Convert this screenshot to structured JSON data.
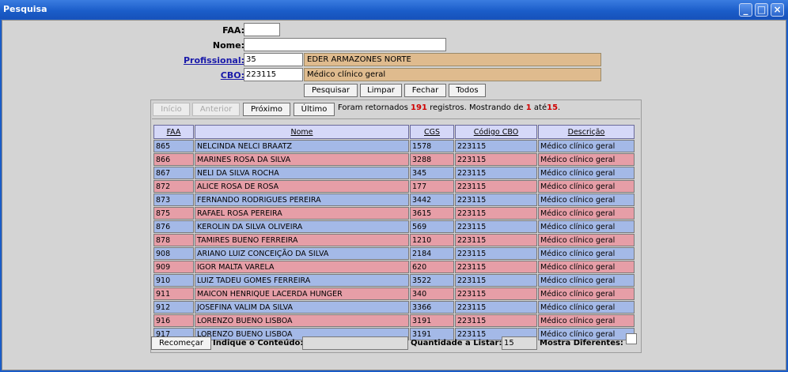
{
  "window": {
    "title": "Pesquisa"
  },
  "form": {
    "faa_label": "FAA:",
    "faa_value": "",
    "nome_label": "Nome:",
    "nome_value": "",
    "profissional_label": "Profissional:",
    "profissional_code": "35",
    "profissional_name": "EDER ARMAZONES NORTE",
    "cbo_label": "CBO:",
    "cbo_code": "223115",
    "cbo_desc": "Médico clínico geral"
  },
  "actions": {
    "pesquisar": "Pesquisar",
    "limpar": "Limpar",
    "fechar": "Fechar",
    "todos": "Todos"
  },
  "nav": {
    "inicio": "Início",
    "anterior": "Anterior",
    "proximo": "Próximo",
    "ultimo": "Último",
    "info_prefix": "Foram retornados",
    "total": "191",
    "info_mid": "registros. Mostrando de",
    "from": "1",
    "info_to": "até",
    "to": "15",
    "info_end": "."
  },
  "table": {
    "headers": [
      "FAA",
      "Nome",
      "CGS",
      "Código CBO",
      "Descrição"
    ],
    "rows": [
      [
        "865",
        "NELCINDA NELCI BRAATZ",
        "1578",
        "223115",
        "Médico clínico geral"
      ],
      [
        "866",
        "MARINES ROSA DA SILVA",
        "3288",
        "223115",
        "Médico clínico geral"
      ],
      [
        "867",
        "NELI DA SILVA ROCHA",
        "345",
        "223115",
        "Médico clínico geral"
      ],
      [
        "872",
        "ALICE ROSA DE ROSA",
        "177",
        "223115",
        "Médico clínico geral"
      ],
      [
        "873",
        "FERNANDO RODRIGUES PEREIRA",
        "3442",
        "223115",
        "Médico clínico geral"
      ],
      [
        "875",
        "RAFAEL ROSA PEREIRA",
        "3615",
        "223115",
        "Médico clínico geral"
      ],
      [
        "876",
        "KEROLIN DA SILVA OLIVEIRA",
        "569",
        "223115",
        "Médico clínico geral"
      ],
      [
        "878",
        "TAMIRES BUENO FERREIRA",
        "1210",
        "223115",
        "Médico clínico geral"
      ],
      [
        "908",
        "ARIANO LUIZ CONCEIÇÃO DA SILVA",
        "2184",
        "223115",
        "Médico clínico geral"
      ],
      [
        "909",
        "IGOR MALTA VARELA",
        "620",
        "223115",
        "Médico clínico geral"
      ],
      [
        "910",
        "LUIZ TADEU GOMES FERREIRA",
        "3522",
        "223115",
        "Médico clínico geral"
      ],
      [
        "911",
        "MAICON HENRIQUE LACERDA HUNGER",
        "340",
        "223115",
        "Médico clínico geral"
      ],
      [
        "912",
        "JOSEFINA VALIM DA SILVA",
        "3366",
        "223115",
        "Médico clínico geral"
      ],
      [
        "916",
        "LORENZO BUENO LISBOA",
        "3191",
        "223115",
        "Médico clínico geral"
      ],
      [
        "917",
        "LORENZO BUENO LISBOA",
        "3191",
        "223115",
        "Médico clínico geral"
      ]
    ]
  },
  "footer": {
    "recomecar": "Recomeçar",
    "conteudo_label": "Indique o Conteúdo:",
    "conteudo_value": "",
    "quantidade_label": "Quantidade a Listar:",
    "quantidade_value": "15",
    "mostra_label": "Mostra Diferentes:"
  },
  "colors": {
    "titlebar": "#1a5cc8",
    "row_odd": "#a4b9e7",
    "row_even": "#e69ea7",
    "readonly_field": "#dfbb8e",
    "highlight_number": "#d00000"
  }
}
